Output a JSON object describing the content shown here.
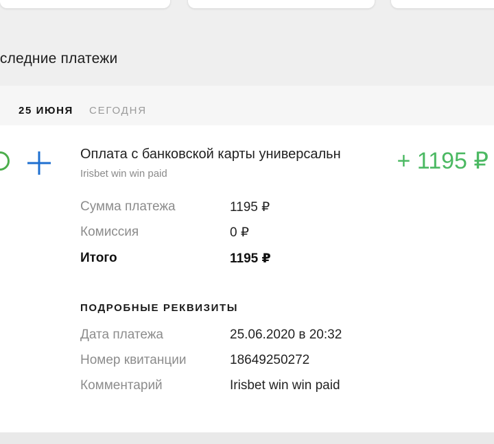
{
  "section": {
    "title": "оследние платежи"
  },
  "date_header": {
    "day": "25 ИЮНЯ",
    "relative": "СЕГОДНЯ"
  },
  "payment": {
    "title": "Оплата с банковской карты универсальн",
    "subtitle": "Irisbet win win paid",
    "amount": "+ 1195 ₽",
    "icon": "plus-icon",
    "accent_color": "#4cb963",
    "icon_color": "#1e6fd0"
  },
  "summary": {
    "rows": [
      {
        "label": "Сумма платежа",
        "value": "1195 ₽"
      },
      {
        "label": "Комиссия",
        "value": "0 ₽"
      },
      {
        "label": "Итого",
        "value": "1195 ₽"
      }
    ]
  },
  "details": {
    "title": "ПОДРОБНЫЕ РЕКВИЗИТЫ",
    "rows": [
      {
        "label": "Дата платежа",
        "value": "25.06.2020 в 20:32"
      },
      {
        "label": "Номер квитанции",
        "value": "18649250272"
      },
      {
        "label": "Комментарий",
        "value": "Irisbet win win paid"
      }
    ]
  }
}
